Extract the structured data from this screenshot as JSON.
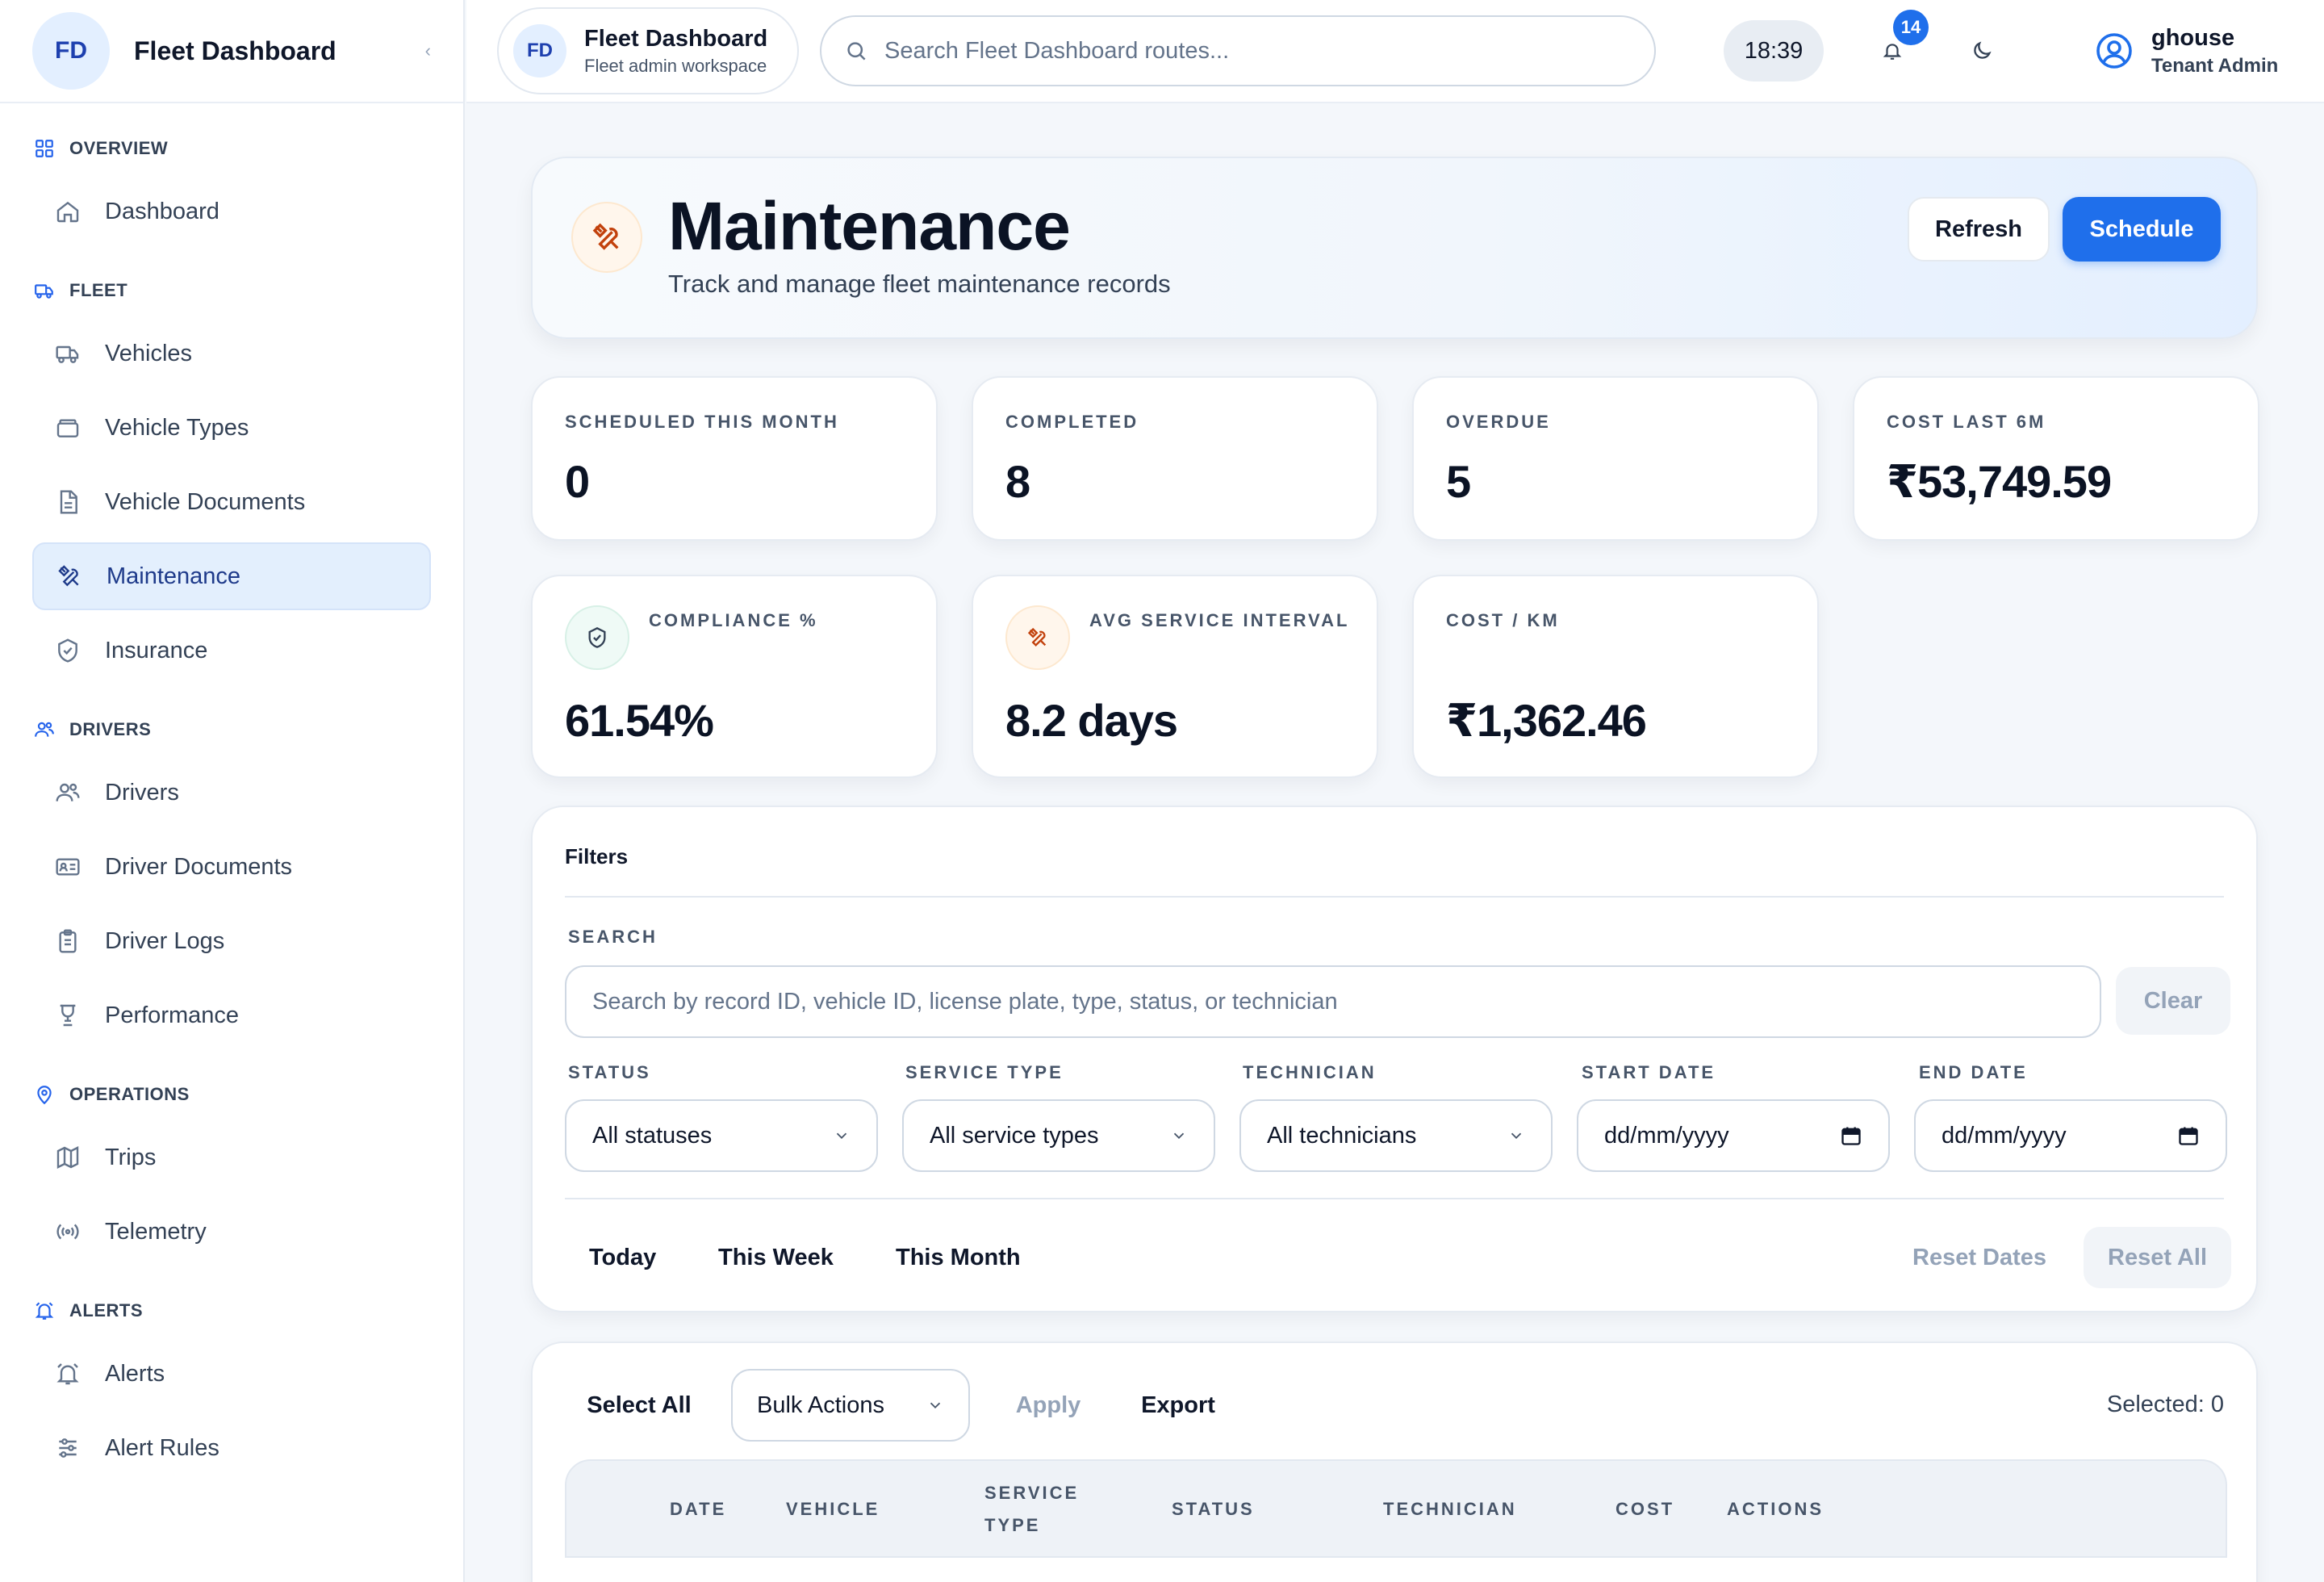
{
  "sidebar": {
    "logo": "FD",
    "title": "Fleet Dashboard",
    "collapse": "‹",
    "sections": {
      "overview": "OVERVIEW",
      "fleet": "FLEET",
      "drivers": "DRIVERS",
      "operations": "OPERATIONS",
      "alerts": "ALERTS"
    },
    "items": {
      "dashboard": "Dashboard",
      "vehicles": "Vehicles",
      "vehicle_types": "Vehicle Types",
      "vehicle_documents": "Vehicle Documents",
      "maintenance": "Maintenance",
      "insurance": "Insurance",
      "drivers": "Drivers",
      "driver_documents": "Driver Documents",
      "driver_logs": "Driver Logs",
      "performance": "Performance",
      "trips": "Trips",
      "telemetry": "Telemetry",
      "alerts": "Alerts",
      "alert_rules": "Alert Rules"
    },
    "active_item": "maintenance"
  },
  "topbar": {
    "workspace_badge": "FD",
    "workspace_title": "Fleet Dashboard",
    "workspace_sub": "Fleet admin workspace",
    "search_placeholder": "Search Fleet Dashboard routes...",
    "clock": "18:39",
    "notifications": "14",
    "user_name": "ghouse",
    "user_role": "Tenant Admin"
  },
  "hero": {
    "title": "Maintenance",
    "subtitle": "Track and manage fleet maintenance records",
    "refresh": "Refresh",
    "schedule": "Schedule"
  },
  "stats": {
    "scheduled": {
      "label": "SCHEDULED THIS MONTH",
      "value": "0"
    },
    "completed": {
      "label": "COMPLETED",
      "value": "8"
    },
    "overdue": {
      "label": "OVERDUE",
      "value": "5"
    },
    "cost6m": {
      "label": "COST LAST 6M",
      "value": "₹53,749.59"
    },
    "compliance": {
      "label": "COMPLIANCE %",
      "value": "61.54%"
    },
    "interval": {
      "label": "AVG SERVICE INTERVAL",
      "value": "8.2 days"
    },
    "costkm": {
      "label": "COST / KM",
      "value": "₹1,362.46"
    }
  },
  "filters": {
    "title": "Filters",
    "search_label": "SEARCH",
    "search_placeholder": "Search by record ID, vehicle ID, license plate, type, status, or technician",
    "clear": "Clear",
    "status_label": "STATUS",
    "status_value": "All statuses",
    "service_label": "SERVICE TYPE",
    "service_value": "All service types",
    "tech_label": "TECHNICIAN",
    "tech_value": "All technicians",
    "start_label": "START DATE",
    "start_value": "dd/mm/yyyy",
    "end_label": "END DATE",
    "end_value": "dd/mm/yyyy",
    "today": "Today",
    "this_week": "This Week",
    "this_month": "This Month",
    "reset_dates": "Reset Dates",
    "reset_all": "Reset All"
  },
  "table": {
    "select_all": "Select All",
    "bulk_actions": "Bulk Actions",
    "apply": "Apply",
    "export": "Export",
    "selected": "Selected: 0",
    "columns": {
      "date": "DATE",
      "vehicle": "VEHICLE",
      "service_1": "SERVICE",
      "service_2": "TYPE",
      "status": "STATUS",
      "technician": "TECHNICIAN",
      "cost": "COST",
      "actions": "ACTIONS"
    }
  }
}
